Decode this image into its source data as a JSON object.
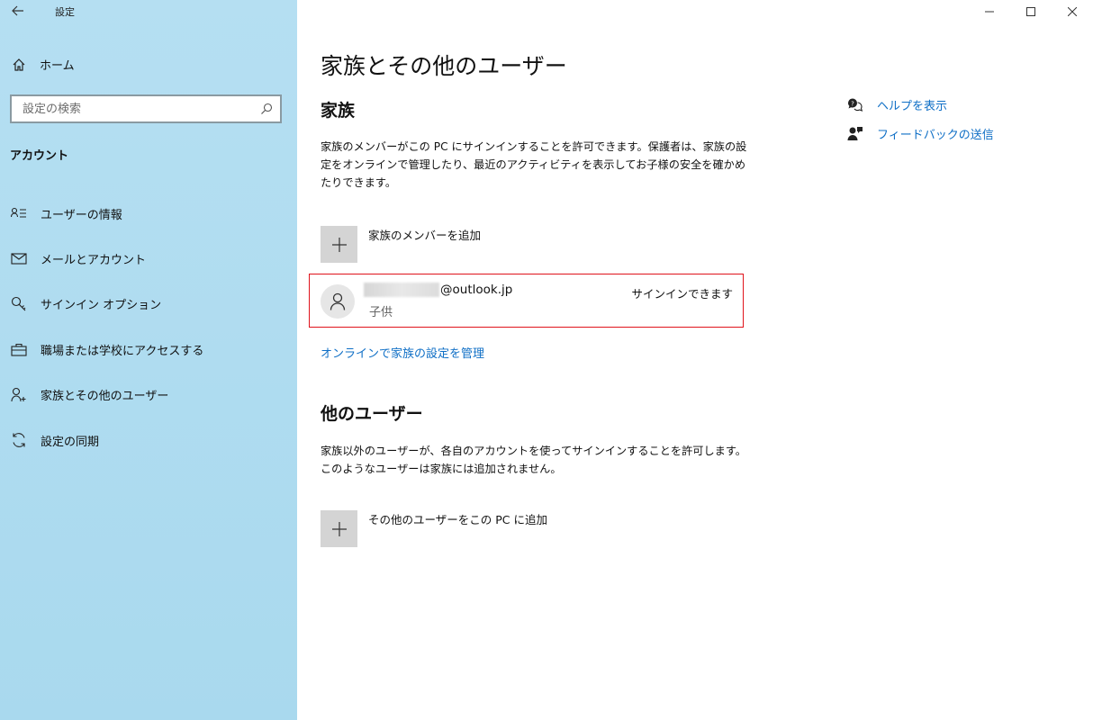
{
  "window": {
    "title": "設定",
    "controls": [
      "minimize",
      "maximize",
      "close"
    ]
  },
  "sidebar": {
    "home_label": "ホーム",
    "search_placeholder": "設定の検索",
    "section_title": "アカウント",
    "items": [
      {
        "label": "ユーザーの情報",
        "icon": "user-info-icon"
      },
      {
        "label": "メールとアカウント",
        "icon": "mail-icon"
      },
      {
        "label": "サインイン オプション",
        "icon": "key-icon"
      },
      {
        "label": "職場または学校にアクセスする",
        "icon": "briefcase-icon"
      },
      {
        "label": "家族とその他のユーザー",
        "icon": "person-add-icon",
        "selected": true
      },
      {
        "label": "設定の同期",
        "icon": "sync-icon"
      }
    ]
  },
  "main": {
    "page_title": "家族とその他のユーザー",
    "family": {
      "heading": "家族",
      "description": "家族のメンバーがこの PC にサインインすることを許可できます。保護者は、家族の設定をオンラインで管理したり、最近のアクティビティを表示してお子様の安全を確かめたりできます。",
      "add_label": "家族のメンバーを追加",
      "member": {
        "email_suffix": "@outlook.jp",
        "role": "子供",
        "status": "サインインできます"
      },
      "manage_link": "オンラインで家族の設定を管理"
    },
    "others": {
      "heading": "他のユーザー",
      "description": "家族以外のユーザーが、各自のアカウントを使ってサインインすることを許可します。このようなユーザーは家族には追加されません。",
      "add_label": "その他のユーザーをこの PC に追加"
    }
  },
  "right_panel": {
    "links": [
      {
        "label": "ヘルプを表示",
        "icon": "help-icon"
      },
      {
        "label": "フィードバックの送信",
        "icon": "feedback-icon"
      }
    ]
  },
  "colors": {
    "sidebar_bg": "#aed9ef",
    "accent_link": "#0f6fc6",
    "highlight_border": "#e0131b"
  }
}
